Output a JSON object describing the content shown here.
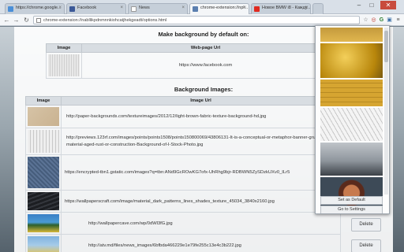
{
  "browser": {
    "tabs": [
      {
        "label": "https://chrome.google...",
        "favicon": "chrome-store-favicon",
        "active": false
      },
      {
        "label": "Facebook",
        "favicon": "facebook-favicon",
        "active": false
      },
      {
        "label": "News",
        "favicon": "page-favicon",
        "active": false
      },
      {
        "label": "chrome-extension://npl...",
        "favicon": "extension-favicon",
        "active": true
      },
      {
        "label": "Новое BMW i8 - Кажду...",
        "favicon": "youtube-favicon",
        "active": false
      }
    ],
    "tab_close_glyph": "×",
    "address": "chrome-extension://nabllikpdnmnnkiohcatjhekgeadt/options.html",
    "nav": {
      "back": "←",
      "forward": "→",
      "reload": "↻"
    },
    "window": {
      "minimize": "–",
      "maximize": "□",
      "close": "✕"
    },
    "toolbar_icons": {
      "star": "☆",
      "ext1": "◎",
      "ext2": "G",
      "ext3": "▣",
      "menu": "≡"
    }
  },
  "default_section": {
    "title": "Make background by default on:",
    "headers": {
      "image": "Image",
      "url": "Web-page Url"
    },
    "row": {
      "url": "https://www.facebook.com"
    }
  },
  "bg_section": {
    "title": "Background Images:",
    "headers": {
      "image": "Image",
      "url": "Image Url"
    },
    "rows": [
      {
        "url": "http://paper-backgrounds.com/textureimages/2012/12/light-brown-fabric-texture-background-hd.jpg"
      },
      {
        "url": "http://previews.123rf.com/images/points/points1508/points150800069/43806131-It-is-a-conceptual-or-metaphor-banner-grunge-material-aged-rust-or-construction-Background-of-I-Stock-Photo.jpg"
      },
      {
        "url": "https://encrypted-tbn1.gstatic.com/images?q=tbn:ANd9GcROwKG7ofx-UhRhg9bjr-RDBWN5ZySDzkUXv0_ILr5"
      },
      {
        "url": "https://wallpaperscraft.com/image/material_dark_patterns_lines_shades_texture_45034_3840x2160.jpg"
      },
      {
        "url": "http://wallpapercave.com/wp/0dWl3fG.jpg"
      },
      {
        "url": "http://atv.md/files/news_images/6bfbda466229e1e79fe255c13e4c3b222.jpg"
      }
    ],
    "delete_label": "Delete"
  },
  "popup": {
    "set_default_label": "Set as Default",
    "settings_label": "Go to Settings"
  }
}
